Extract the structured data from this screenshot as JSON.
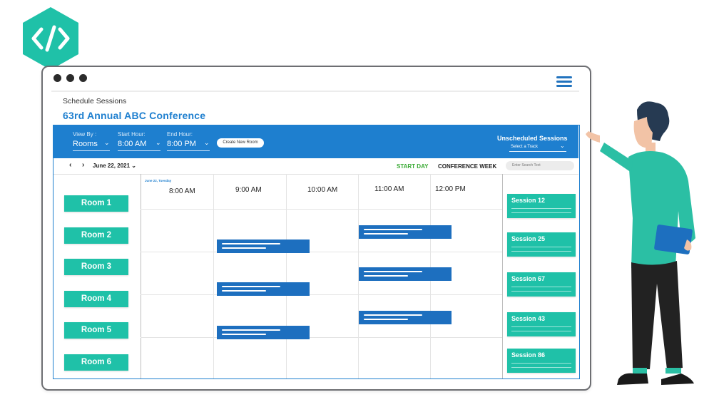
{
  "badge": {
    "icon": "code-brackets-icon",
    "color": "#1fc1a8"
  },
  "window": {
    "menu_icon": "hamburger-menu-icon",
    "section_label": "Schedule Sessions",
    "title": "63rd Annual ABC Conference"
  },
  "toolbar": {
    "view_by": {
      "label": "View By :",
      "value": "Rooms"
    },
    "start_hour": {
      "label": "Start Hour:",
      "value": "8:00 AM"
    },
    "end_hour": {
      "label": "End Hour:",
      "value": "8:00 PM"
    },
    "create_room_label": "Create New Room",
    "unscheduled_title": "Unscheduled Sessions",
    "track_placeholder": "Select a Track"
  },
  "nav": {
    "date": "June 22, 2021",
    "start_day_label": "START DAY",
    "conference_week_label": "CONFERENCE WEEK",
    "search_placeholder": "Enter Search Text"
  },
  "grid": {
    "day_label": "June 22, Tuesday",
    "times": [
      "8:00 AM",
      "9:00 AM",
      "10:00 AM",
      "11:00 AM",
      "12:00 PM"
    ]
  },
  "rooms": [
    "Room 1",
    "Room 2",
    "Room 3",
    "Room 4",
    "Room 5",
    "Room 6"
  ],
  "unscheduled": [
    "Session 12",
    "Session 25",
    "Session 67",
    "Session 43",
    "Session 86"
  ],
  "colors": {
    "accent": "#1e7fcf",
    "teal": "#1fc1a8",
    "session_block": "#1d6fbf",
    "start_day": "#3aaa35"
  }
}
